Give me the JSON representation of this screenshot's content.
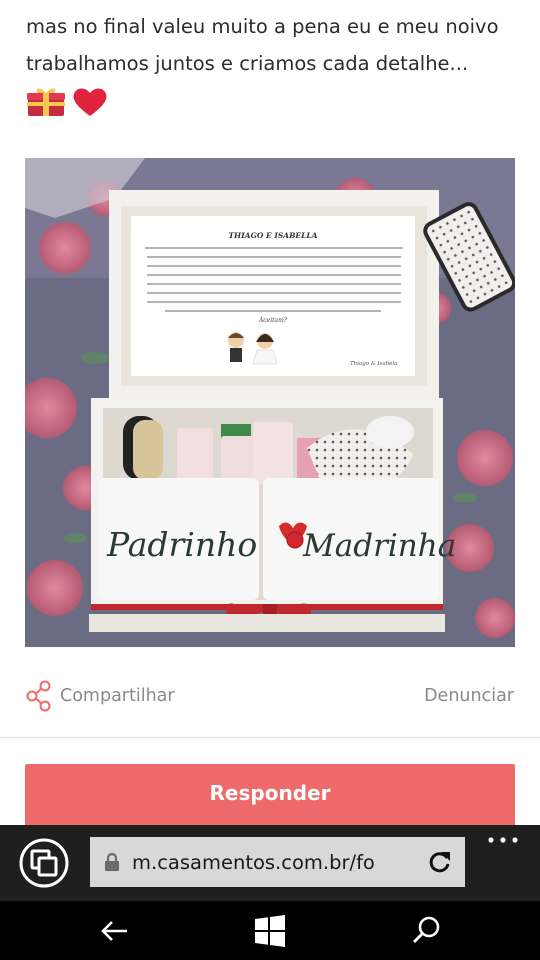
{
  "post": {
    "text": "mas no final valeu muito a pena eu e meu noivo trabalhamos juntos e criamos cada detalhe...",
    "emojis": [
      "gift-icon",
      "heart-icon"
    ]
  },
  "photo": {
    "card_title": "THIAGO E ISABELLA",
    "card_closing": "Aceitam?",
    "card_signature": "Thiago & Isabela",
    "towel_left": "Padrinho",
    "towel_right": "Madrinha"
  },
  "actions": {
    "share_label": "Compartilhar",
    "report_label": "Denunciar"
  },
  "reply": {
    "label": "Responder"
  },
  "browser": {
    "url": "m.casamentos.com.br/fo"
  },
  "colors": {
    "accent": "#ef6a6a",
    "browser_bar": "#1f1f1f",
    "nav_bar": "#000000"
  }
}
